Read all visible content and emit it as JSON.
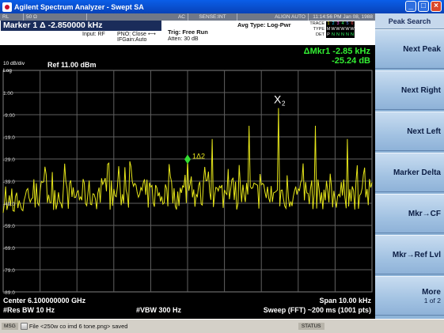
{
  "window": {
    "title": "Agilent Spectrum Analyzer - Swept SA",
    "minimize": "_",
    "maximize": "□",
    "close": "×"
  },
  "status_strip": {
    "items": [
      "RL",
      "50 Ω",
      "AC",
      "SENSE:INT",
      "ALIGN AUTO",
      "11:14:56 PM Jan 08, 1988"
    ]
  },
  "settings": {
    "marker_title": "Marker 1 Δ  -2.850000 kHz",
    "input": "Input: RF",
    "pno": "PNO: Close",
    "ifgain": "IFGain:Auto",
    "trig": "Trig: Free Run",
    "atten": "Atten: 30 dB",
    "avg_type": "Avg Type: Log-Pwr",
    "trace_labels": [
      "TRACE",
      "TYPE",
      "DET"
    ],
    "trace_row": "1 2 3 4 5 6",
    "type_row": "M W W W W W",
    "det_row": "P N N N N N"
  },
  "plot": {
    "scale": "10 dB/div",
    "scale_type": "Log",
    "ref_level": "Ref 11.00 dBm",
    "marker_delta_label": "ΔMkr1 -2.85 kHz",
    "marker_delta_value": "-25.24 dB",
    "y_ticks": [
      "1.00",
      "-9.00",
      "-19.0",
      "-29.0",
      "-39.0",
      "-49.0",
      "-59.0",
      "-69.0",
      "-79.0",
      "-89.0"
    ],
    "marker_1_label": "1Δ2",
    "marker_2_label": "X",
    "marker_2_sub": "2",
    "center": "Center 6.100000000 GHz",
    "res_bw": "#Res BW 10 Hz",
    "vbw": "#VBW 300 Hz",
    "span": "Span 10.00 kHz",
    "sweep": "Sweep (FFT)  ~200 ms (1001 pts)",
    "trace_color": "#e6e61a"
  },
  "softkeys": {
    "header": "Peak Search",
    "keys": [
      {
        "label": "Next Peak",
        "sub": ""
      },
      {
        "label": "Next Right",
        "sub": ""
      },
      {
        "label": "Next Left",
        "sub": ""
      },
      {
        "label": "Marker Delta",
        "sub": ""
      },
      {
        "label": "Mkr→CF",
        "sub": ""
      },
      {
        "label": "Mkr→Ref Lvl",
        "sub": ""
      },
      {
        "label": "More",
        "sub": "1 of 2"
      }
    ]
  },
  "bottom_bar": {
    "msg_label": "MSG",
    "message": "File <250w co imd 6 tone.png> saved",
    "status_label": "STATUS"
  }
}
